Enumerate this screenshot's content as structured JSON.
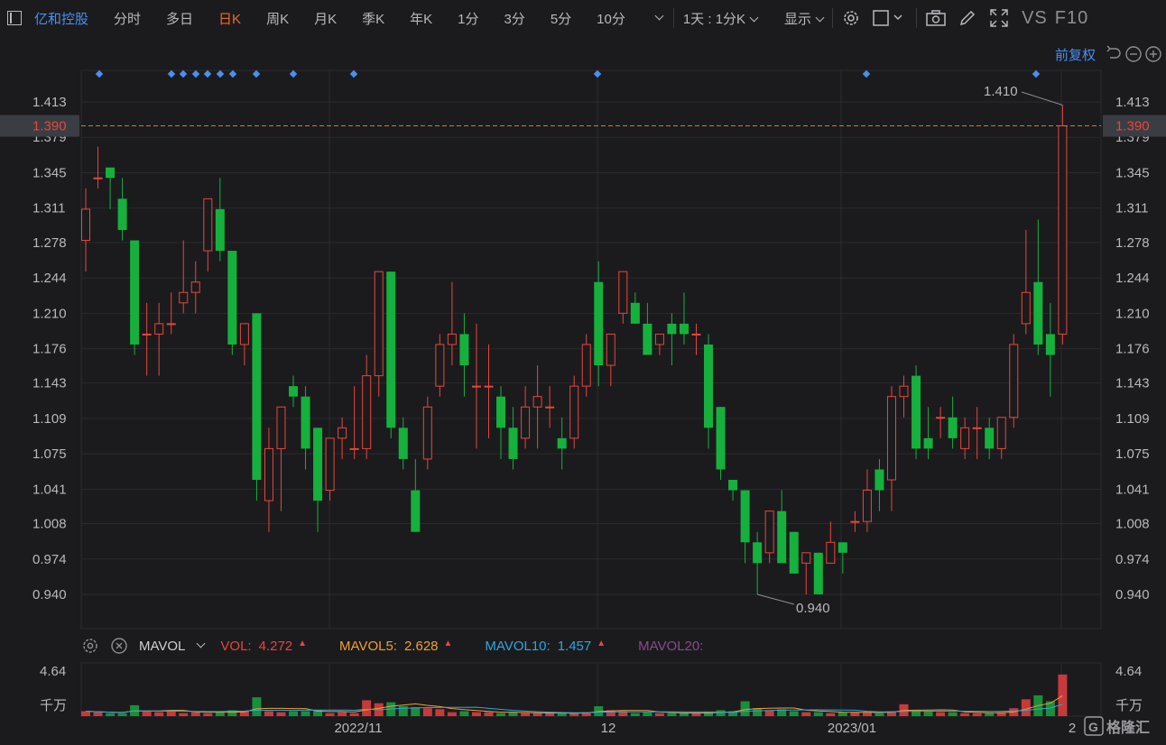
{
  "toolbar": {
    "stock_name": "亿和控股",
    "periods": [
      "分时",
      "多日",
      "日K",
      "周K",
      "月K",
      "季K",
      "年K",
      "1分",
      "3分",
      "5分",
      "10分"
    ],
    "active_period": "日K",
    "interval_select": "1天 : 1分K",
    "display_label": "显示",
    "vs_label": "VS",
    "f10_label": "F10"
  },
  "adjust_label": "前复权",
  "colors": {
    "up": "#e8463a",
    "down": "#16b03d",
    "grid": "#2b2b2f",
    "price_line": "#f26a2a",
    "ma5": "#f0a030",
    "ma10": "#2aa7e0"
  },
  "chart_data": {
    "type": "candlestick",
    "current_price": "1.390",
    "y_ticks": [
      "1.413",
      "1.379",
      "1.345",
      "1.311",
      "1.278",
      "1.244",
      "1.210",
      "1.176",
      "1.143",
      "1.109",
      "1.075",
      "1.041",
      "1.008",
      "0.974",
      "0.940"
    ],
    "ylim": [
      0.9,
      1.44
    ],
    "x_labels": [
      "2022/11",
      "12",
      "2023/01",
      "2"
    ],
    "high_label": "1.410",
    "low_label": "0.940",
    "candles": [
      {
        "o": 1.28,
        "h": 1.33,
        "l": 1.25,
        "c": 1.31
      },
      {
        "o": 1.34,
        "h": 1.37,
        "l": 1.33,
        "c": 1.34
      },
      {
        "o": 1.35,
        "h": 1.35,
        "l": 1.31,
        "c": 1.34
      },
      {
        "o": 1.32,
        "h": 1.34,
        "l": 1.28,
        "c": 1.29
      },
      {
        "o": 1.28,
        "h": 1.28,
        "l": 1.17,
        "c": 1.18
      },
      {
        "o": 1.19,
        "h": 1.22,
        "l": 1.15,
        "c": 1.19
      },
      {
        "o": 1.19,
        "h": 1.22,
        "l": 1.15,
        "c": 1.2
      },
      {
        "o": 1.2,
        "h": 1.23,
        "l": 1.19,
        "c": 1.2
      },
      {
        "o": 1.22,
        "h": 1.28,
        "l": 1.21,
        "c": 1.23
      },
      {
        "o": 1.23,
        "h": 1.26,
        "l": 1.21,
        "c": 1.24
      },
      {
        "o": 1.27,
        "h": 1.32,
        "l": 1.25,
        "c": 1.32
      },
      {
        "o": 1.31,
        "h": 1.34,
        "l": 1.26,
        "c": 1.27
      },
      {
        "o": 1.27,
        "h": 1.27,
        "l": 1.17,
        "c": 1.18
      },
      {
        "o": 1.18,
        "h": 1.2,
        "l": 1.16,
        "c": 1.2
      },
      {
        "o": 1.21,
        "h": 1.21,
        "l": 1.03,
        "c": 1.05
      },
      {
        "o": 1.03,
        "h": 1.1,
        "l": 1.0,
        "c": 1.08
      },
      {
        "o": 1.08,
        "h": 1.12,
        "l": 1.02,
        "c": 1.12
      },
      {
        "o": 1.14,
        "h": 1.15,
        "l": 1.12,
        "c": 1.13
      },
      {
        "o": 1.13,
        "h": 1.14,
        "l": 1.06,
        "c": 1.08
      },
      {
        "o": 1.1,
        "h": 1.1,
        "l": 1.0,
        "c": 1.03
      },
      {
        "o": 1.04,
        "h": 1.09,
        "l": 1.03,
        "c": 1.09
      },
      {
        "o": 1.09,
        "h": 1.11,
        "l": 1.07,
        "c": 1.1
      },
      {
        "o": 1.08,
        "h": 1.14,
        "l": 1.07,
        "c": 1.08
      },
      {
        "o": 1.08,
        "h": 1.17,
        "l": 1.07,
        "c": 1.15
      },
      {
        "o": 1.15,
        "h": 1.25,
        "l": 1.13,
        "c": 1.25
      },
      {
        "o": 1.25,
        "h": 1.25,
        "l": 1.09,
        "c": 1.1
      },
      {
        "o": 1.1,
        "h": 1.11,
        "l": 1.06,
        "c": 1.07
      },
      {
        "o": 1.04,
        "h": 1.07,
        "l": 1.0,
        "c": 1.0
      },
      {
        "o": 1.07,
        "h": 1.13,
        "l": 1.06,
        "c": 1.12
      },
      {
        "o": 1.14,
        "h": 1.19,
        "l": 1.13,
        "c": 1.18
      },
      {
        "o": 1.18,
        "h": 1.24,
        "l": 1.16,
        "c": 1.19
      },
      {
        "o": 1.19,
        "h": 1.21,
        "l": 1.13,
        "c": 1.16
      },
      {
        "o": 1.14,
        "h": 1.2,
        "l": 1.08,
        "c": 1.14
      },
      {
        "o": 1.14,
        "h": 1.18,
        "l": 1.09,
        "c": 1.14
      },
      {
        "o": 1.13,
        "h": 1.14,
        "l": 1.07,
        "c": 1.1
      },
      {
        "o": 1.1,
        "h": 1.12,
        "l": 1.06,
        "c": 1.07
      },
      {
        "o": 1.09,
        "h": 1.14,
        "l": 1.08,
        "c": 1.12
      },
      {
        "o": 1.12,
        "h": 1.16,
        "l": 1.08,
        "c": 1.13
      },
      {
        "o": 1.12,
        "h": 1.14,
        "l": 1.1,
        "c": 1.12
      },
      {
        "o": 1.09,
        "h": 1.11,
        "l": 1.06,
        "c": 1.08
      },
      {
        "o": 1.09,
        "h": 1.15,
        "l": 1.08,
        "c": 1.14
      },
      {
        "o": 1.14,
        "h": 1.19,
        "l": 1.13,
        "c": 1.18
      },
      {
        "o": 1.24,
        "h": 1.26,
        "l": 1.14,
        "c": 1.16
      },
      {
        "o": 1.16,
        "h": 1.19,
        "l": 1.14,
        "c": 1.19
      },
      {
        "o": 1.21,
        "h": 1.25,
        "l": 1.2,
        "c": 1.25
      },
      {
        "o": 1.22,
        "h": 1.23,
        "l": 1.2,
        "c": 1.2
      },
      {
        "o": 1.2,
        "h": 1.22,
        "l": 1.17,
        "c": 1.17
      },
      {
        "o": 1.18,
        "h": 1.19,
        "l": 1.17,
        "c": 1.19
      },
      {
        "o": 1.2,
        "h": 1.21,
        "l": 1.16,
        "c": 1.19
      },
      {
        "o": 1.2,
        "h": 1.23,
        "l": 1.18,
        "c": 1.19
      },
      {
        "o": 1.19,
        "h": 1.2,
        "l": 1.17,
        "c": 1.19
      },
      {
        "o": 1.18,
        "h": 1.19,
        "l": 1.08,
        "c": 1.1
      },
      {
        "o": 1.12,
        "h": 1.12,
        "l": 1.05,
        "c": 1.06
      },
      {
        "o": 1.05,
        "h": 1.05,
        "l": 1.03,
        "c": 1.04
      },
      {
        "o": 1.04,
        "h": 1.04,
        "l": 0.97,
        "c": 0.99
      },
      {
        "o": 0.99,
        "h": 1.0,
        "l": 0.94,
        "c": 0.97
      },
      {
        "o": 0.98,
        "h": 1.02,
        "l": 0.97,
        "c": 1.02
      },
      {
        "o": 1.02,
        "h": 1.04,
        "l": 0.97,
        "c": 0.97
      },
      {
        "o": 1.0,
        "h": 1.0,
        "l": 0.96,
        "c": 0.96
      },
      {
        "o": 0.97,
        "h": 0.98,
        "l": 0.94,
        "c": 0.98
      },
      {
        "o": 0.98,
        "h": 0.98,
        "l": 0.94,
        "c": 0.94
      },
      {
        "o": 0.97,
        "h": 1.01,
        "l": 0.97,
        "c": 0.99
      },
      {
        "o": 0.99,
        "h": 0.99,
        "l": 0.96,
        "c": 0.98
      },
      {
        "o": 1.01,
        "h": 1.02,
        "l": 1.0,
        "c": 1.01
      },
      {
        "o": 1.01,
        "h": 1.06,
        "l": 1.0,
        "c": 1.04
      },
      {
        "o": 1.06,
        "h": 1.07,
        "l": 1.02,
        "c": 1.04
      },
      {
        "o": 1.05,
        "h": 1.14,
        "l": 1.02,
        "c": 1.13
      },
      {
        "o": 1.13,
        "h": 1.15,
        "l": 1.11,
        "c": 1.14
      },
      {
        "o": 1.15,
        "h": 1.16,
        "l": 1.07,
        "c": 1.08
      },
      {
        "o": 1.09,
        "h": 1.12,
        "l": 1.07,
        "c": 1.08
      },
      {
        "o": 1.11,
        "h": 1.12,
        "l": 1.09,
        "c": 1.11
      },
      {
        "o": 1.11,
        "h": 1.13,
        "l": 1.08,
        "c": 1.09
      },
      {
        "o": 1.08,
        "h": 1.11,
        "l": 1.07,
        "c": 1.1
      },
      {
        "o": 1.1,
        "h": 1.12,
        "l": 1.07,
        "c": 1.1
      },
      {
        "o": 1.1,
        "h": 1.11,
        "l": 1.07,
        "c": 1.08
      },
      {
        "o": 1.08,
        "h": 1.11,
        "l": 1.07,
        "c": 1.11
      },
      {
        "o": 1.11,
        "h": 1.19,
        "l": 1.1,
        "c": 1.18
      },
      {
        "o": 1.2,
        "h": 1.29,
        "l": 1.19,
        "c": 1.23
      },
      {
        "o": 1.24,
        "h": 1.3,
        "l": 1.17,
        "c": 1.18
      },
      {
        "o": 1.19,
        "h": 1.22,
        "l": 1.13,
        "c": 1.17
      },
      {
        "o": 1.19,
        "h": 1.41,
        "l": 1.18,
        "c": 1.39
      }
    ],
    "volume_ticks": [
      "4.64",
      "千万"
    ],
    "volume_ylim": [
      0,
      4.64
    ],
    "volumes": [
      0.5,
      0.4,
      0.3,
      0.3,
      1.1,
      0.5,
      0.4,
      0.6,
      0.3,
      0.4,
      0.3,
      0.4,
      0.6,
      0.5,
      1.9,
      0.5,
      0.4,
      0.5,
      0.5,
      0.6,
      0.3,
      0.4,
      0.3,
      1.6,
      1.3,
      1.4,
      1.0,
      0.9,
      0.8,
      0.7,
      0.4,
      0.5,
      0.4,
      0.4,
      0.3,
      0.4,
      0.3,
      0.3,
      0.3,
      0.3,
      0.3,
      0.4,
      1.0,
      0.6,
      0.5,
      0.3,
      0.4,
      0.3,
      0.3,
      0.3,
      0.3,
      0.4,
      0.6,
      0.5,
      1.5,
      0.8,
      0.6,
      0.7,
      0.5,
      0.4,
      0.4,
      0.3,
      0.4,
      0.4,
      0.4,
      0.3,
      0.5,
      1.2,
      0.6,
      0.5,
      0.4,
      0.4,
      0.3,
      0.3,
      0.3,
      0.4,
      0.8,
      1.7,
      2.1,
      1.5,
      4.2
    ],
    "volume_label": "MAVOL",
    "vol_stats": [
      {
        "name": "VOL:",
        "value": "4.272"
      },
      {
        "name": "MAVOL5:",
        "value": "2.628"
      },
      {
        "name": "MAVOL10:",
        "value": "1.457"
      },
      {
        "name": "MAVOL20:",
        "value": ""
      }
    ]
  }
}
